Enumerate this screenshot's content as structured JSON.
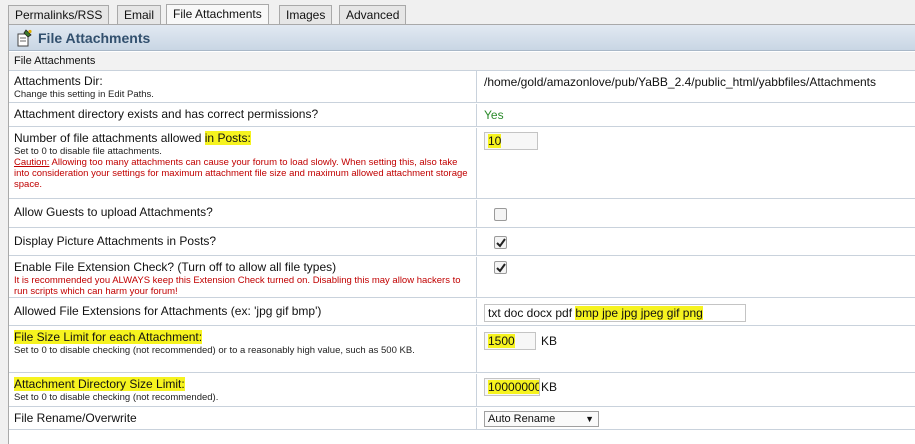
{
  "tabs": [
    "Permalinks/RSS",
    "Email",
    "File Attachments",
    "Images",
    "Advanced"
  ],
  "active_tab": "File Attachments",
  "panel": {
    "title": "File Attachments",
    "subtitle": "File Attachments"
  },
  "settings": {
    "attach_dir": {
      "label": "Attachments Dir:",
      "desc": "Change this setting in Edit Paths.",
      "value": "/home/gold/amazonlove/pub/YaBB_2.4/public_html/yabbfiles/Attachments"
    },
    "dir_exists": {
      "label": "Attachment directory exists and has correct permissions?",
      "value": "Yes"
    },
    "num_attach": {
      "label_a": "Number of file attachments allowed ",
      "label_b": "in Posts:",
      "desc": "Set to 0 to disable file attachments.",
      "caution_word": "Caution:",
      "caution": " Allowing too many attachments can cause your forum to load slowly. When setting this, also take into consideration your settings for maximum attachment file size and maximum allowed attachment storage space.",
      "value": "10"
    },
    "guest_upload": {
      "label": "Allow Guests to upload Attachments?",
      "checked": false
    },
    "display_pics": {
      "label": "Display Picture Attachments in Posts?",
      "checked": true
    },
    "ext_check": {
      "label": "Enable File Extension Check? (Turn off to allow all file types)",
      "warning": "It is recommended you ALWAYS keep this Extension Check turned on. Disabling this may allow hackers to run scripts which can harm your forum!",
      "checked": true
    },
    "extensions": {
      "label": "Allowed File Extensions for Attachments (ex: 'jpg gif bmp')",
      "value_a": "txt doc docx pdf ",
      "value_b": "bmp jpe jpg jpeg gif png"
    },
    "file_size": {
      "label": "File Size Limit for each Attachment:",
      "desc": "Set to 0 to disable checking (not recommended) or to a reasonably high value, such as 500 KB.",
      "value": "1500",
      "unit": "KB"
    },
    "dir_size": {
      "label": "Attachment Directory Size Limit:",
      "desc": "Set to 0 to disable checking (not recommended).",
      "value": "10000000",
      "unit": "KB"
    },
    "rename": {
      "label": "File Rename/Overwrite",
      "value": "Auto Rename"
    }
  },
  "colors": {
    "highlight": "#f6f31f",
    "warning": "#c00000",
    "yes": "#2a8a2a",
    "title": "#32506e"
  }
}
